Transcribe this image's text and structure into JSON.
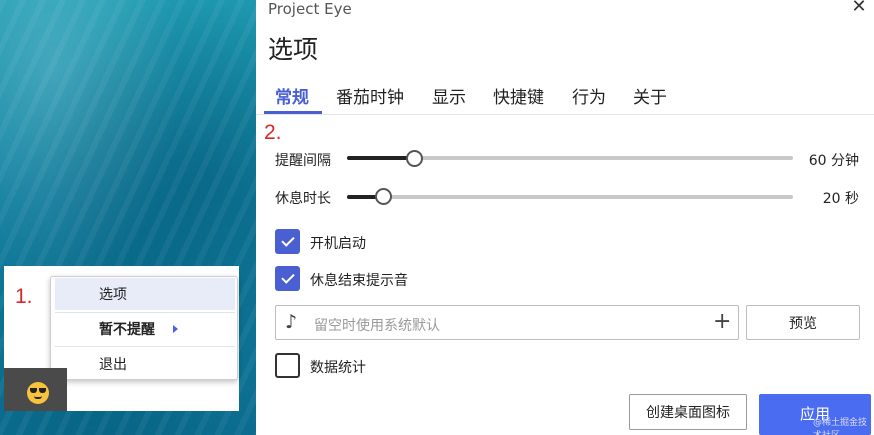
{
  "annotations": {
    "step1": "1.",
    "step2": "2."
  },
  "context_menu": {
    "items": [
      {
        "label": "选项",
        "highlighted": true
      },
      {
        "label": "暂不提醒",
        "has_submenu": true
      },
      {
        "label": "退出"
      }
    ]
  },
  "tray": {
    "icon": "sunglasses-face-icon"
  },
  "window": {
    "app_title": "Project Eye",
    "close_icon": "close-icon",
    "page_title": "选项",
    "tabs": [
      {
        "label": "常规",
        "active": true
      },
      {
        "label": "番茄时钟"
      },
      {
        "label": "显示"
      },
      {
        "label": "快捷键"
      },
      {
        "label": "行为"
      },
      {
        "label": "关于"
      }
    ],
    "reminder_interval": {
      "label": "提醒间隔",
      "value": "60 分钟",
      "slider_fraction": 0.15
    },
    "rest_duration": {
      "label": "休息时长",
      "value": "20 秒",
      "slider_fraction": 0.08
    },
    "checkboxes": [
      {
        "label": "开机启动",
        "checked": true
      },
      {
        "label": "休息结束提示音",
        "checked": true
      }
    ],
    "sound_field": {
      "placeholder": "留空时使用系统默认",
      "icon": "music-note-icon",
      "add_icon": "plus-icon"
    },
    "preview_button": "预览",
    "stats_checkbox": {
      "label": "数据统计",
      "checked": false
    },
    "create_shortcut_button": "创建桌面图标",
    "apply_button": "应用",
    "watermark": "@稀土掘金技术社区",
    "accent_color": "#4a5fd1"
  }
}
